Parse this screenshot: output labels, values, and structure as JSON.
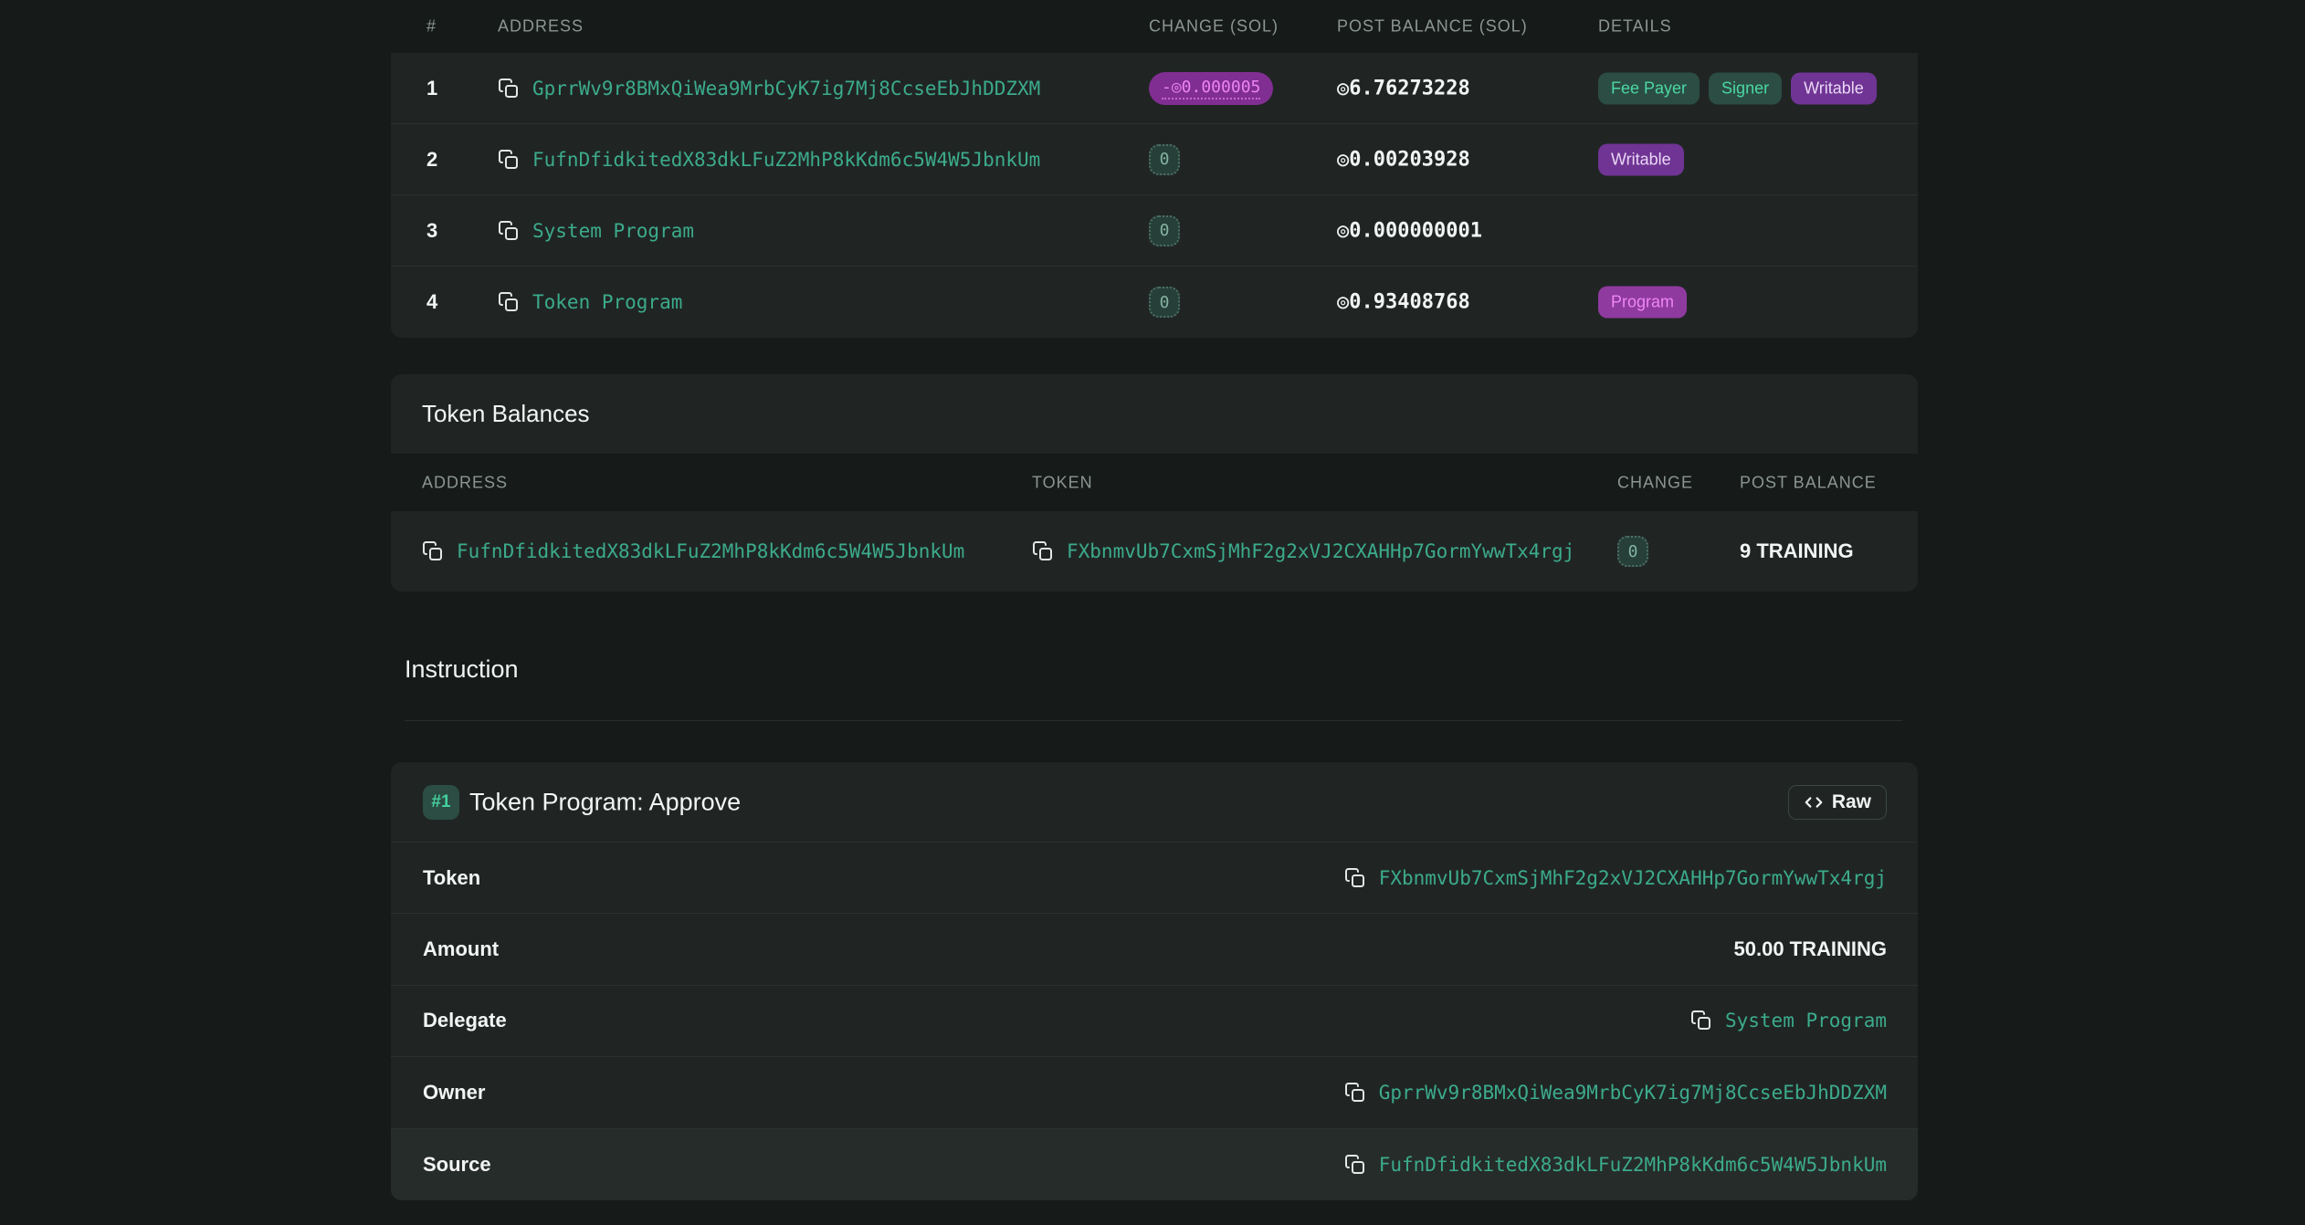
{
  "accounts_table": {
    "columns": [
      "#",
      "Address",
      "Change (SOL)",
      "Post Balance (SOL)",
      "Details"
    ],
    "rows": [
      {
        "index": "1",
        "address": "GprrWv9r8BMxQiWea9MrbCyK7ig7Mj8CcseEbJhDDZXM",
        "change": "-◎0.000005",
        "post_balance": "◎6.76273228",
        "badges": [
          {
            "label": "Fee Payer"
          },
          {
            "label": "Signer"
          },
          {
            "label": "Writable"
          }
        ]
      },
      {
        "index": "2",
        "address": "FufnDfidkitedX83dkLFuZ2MhP8kKdm6c5W4W5JbnkUm",
        "change": "0",
        "post_balance": "◎0.00203928",
        "badges": [
          {
            "label": "Writable"
          }
        ]
      },
      {
        "index": "3",
        "address": "System Program",
        "change": "0",
        "post_balance": "◎0.000000001",
        "badges": []
      },
      {
        "index": "4",
        "address": "Token Program",
        "change": "0",
        "post_balance": "◎0.93408768",
        "badges": [
          {
            "label": "Program"
          }
        ]
      }
    ]
  },
  "token_balances": {
    "title": "Token Balances",
    "columns": [
      "Address",
      "Token",
      "Change",
      "Post Balance"
    ],
    "rows": [
      {
        "address": "FufnDfidkitedX83dkLFuZ2MhP8kKdm6c5W4W5JbnkUm",
        "token": "FXbnmvUb7CxmSjMhF2g2xVJ2CXAHHp7GormYwwTx4rgj",
        "change": "0",
        "post_balance": "9 TRAINING"
      }
    ]
  },
  "instruction": {
    "heading": "Instruction",
    "card": {
      "index_badge": "#1",
      "title": "Token Program: Approve",
      "raw_button": "Raw",
      "fields": [
        {
          "label": "Token",
          "value": "FXbnmvUb7CxmSjMhF2g2xVJ2CXAHHp7GormYwwTx4rgj"
        },
        {
          "label": "Amount",
          "value": "50.00 TRAINING"
        },
        {
          "label": "Delegate",
          "value": "System Program"
        },
        {
          "label": "Owner",
          "value": "GprrWv9r8BMxQiWea9MrbCyK7ig7Mj8CcseEbJhDDZXM"
        },
        {
          "label": "Source",
          "value": "FufnDfidkitedX83dkLFuZ2MhP8kKdm6c5W4W5JbnkUm"
        }
      ]
    }
  },
  "colors": {
    "page_bg": "#161a19",
    "panel_bg": "#202524",
    "header_bg": "#161a19",
    "address_green": "#3cab8b",
    "badge_teal_bg": "#2b4d43",
    "badge_teal_text": "#4cd7a4",
    "badge_purple_bg": "#6f3494",
    "badge_purple_text": "#ead7f6",
    "badge_magenta_bg": "#8f3a9f",
    "badge_magenta_text": "#ef86f3",
    "change_negative_bg": "#812e92",
    "change_negative_text": "#ec84f2"
  }
}
